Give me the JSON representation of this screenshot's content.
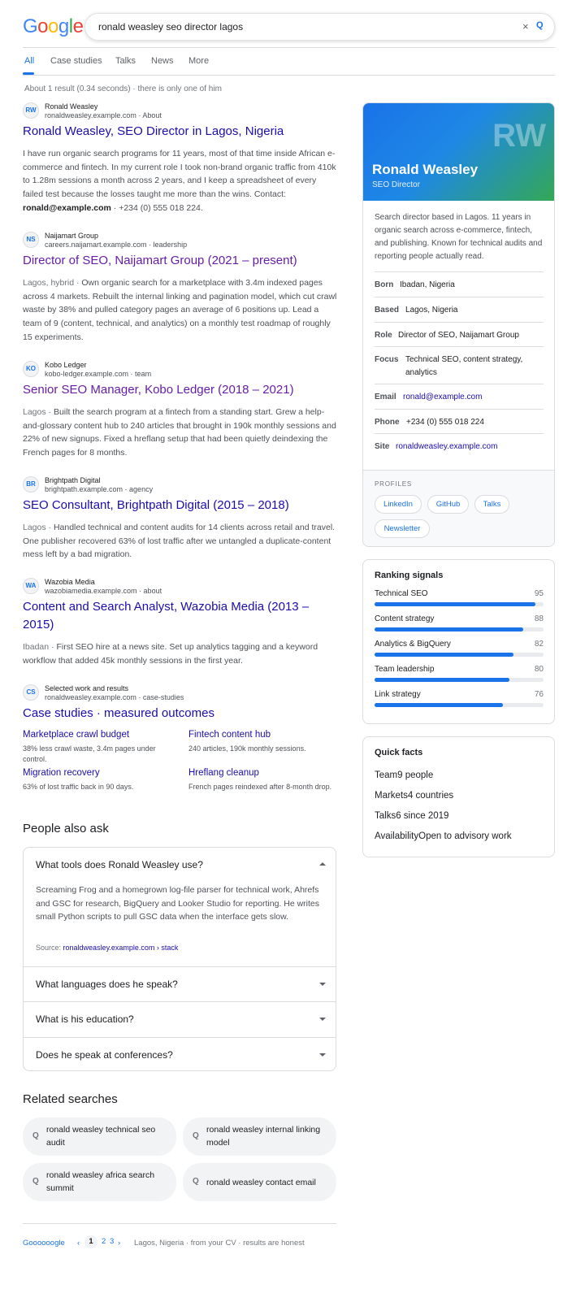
{
  "search": {
    "logo_letters": [
      {
        "char": "G",
        "color": "#4285f4"
      },
      {
        "char": "o",
        "color": "#ea4335"
      },
      {
        "char": "o",
        "color": "#fbbc05"
      },
      {
        "char": "g",
        "color": "#4285f4"
      },
      {
        "char": "l",
        "color": "#34a853"
      },
      {
        "char": "e",
        "color": "#ea4335"
      }
    ],
    "query": "ronald weasley seo director lagos",
    "clear_icon": "×",
    "search_icon": "Q"
  },
  "tabs": [
    "All",
    "Case studies",
    "Talks",
    "News",
    "More"
  ],
  "result_stats": "About 1 result (0.34 seconds) · there is only one of him",
  "results": [
    {
      "favicon": "RW",
      "site": "Ronald Weasley",
      "url": "ronaldweasley.example.com · About",
      "title": "Ronald Weasley, SEO Director in Lagos, Nigeria",
      "snippet_before": "I have run organic search programs for 11 years, most of that time inside African e-commerce and fintech. In my current role I took non-brand organic traffic from 410k to 1.28m sessions a month across 2 years, and I keep a spreadsheet of every failed test because the losses taught me more than the wins. Contact: ",
      "snippet_bold": "ronald@example.com",
      "snippet_after": " · +234 (0) 555 018 224."
    },
    {
      "favicon": "NS",
      "site": "Naijamart Group",
      "url": "careers.naijamart.example.com · leadership",
      "title": "Director of SEO, Naijamart Group (2021 – present)",
      "prefix": "Lagos, hybrid · ",
      "snippet": "Own organic search for a marketplace with 3.4m indexed pages across 4 markets. Rebuilt the internal linking and pagination model, which cut crawl waste by 38% and pulled category pages an average of 6 positions up. Lead a team of 9 (content, technical, and analytics) on a monthly test roadmap of roughly 15 experiments."
    },
    {
      "favicon": "KO",
      "site": "Kobo Ledger",
      "url": "kobo-ledger.example.com · team",
      "title": "Senior SEO Manager, Kobo Ledger (2018 – 2021)",
      "prefix": "Lagos · ",
      "snippet": "Built the search program at a fintech from a standing start. Grew a help-and-glossary content hub to 240 articles that brought in 190k monthly sessions and 22% of new signups. Fixed a hreflang setup that had been quietly deindexing the French pages for 8 months."
    },
    {
      "favicon": "BR",
      "site": "Brightpath Digital",
      "url": "brightpath.example.com · agency",
      "title": "SEO Consultant, Brightpath Digital (2015 – 2018)",
      "prefix": "Lagos · ",
      "snippet": "Handled technical and content audits for 14 clients across retail and travel. One publisher recovered 63% of lost traffic after we untangled a duplicate-content mess left by a bad migration."
    },
    {
      "favicon": "WA",
      "site": "Wazobia Media",
      "url": "wazobiamedia.example.com · about",
      "title": "Content and Search Analyst, Wazobia Media (2013 – 2015)",
      "prefix": "Ibadan · ",
      "snippet": "First SEO hire at a news site. Set up analytics tagging and a keyword workflow that added 45k monthly sessions in the first year."
    },
    {
      "favicon": "CS",
      "site": "Selected work and results",
      "url": "ronaldweasley.example.com · case-studies",
      "title": "Case studies · measured outcomes"
    }
  ],
  "case_studies": [
    {
      "title": "Marketplace crawl budget",
      "desc": "38% less crawl waste, 3.4m pages under control."
    },
    {
      "title": "Fintech content hub",
      "desc": "240 articles, 190k monthly sessions."
    },
    {
      "title": "Migration recovery",
      "desc": "63% of lost traffic back in 90 days."
    },
    {
      "title": "Hreflang cleanup",
      "desc": "French pages reindexed after 8-month drop."
    }
  ],
  "paa": {
    "title": "People also ask",
    "questions": [
      "What tools does Ronald Weasley use?",
      "What languages does he speak?",
      "What is his education?",
      "Does he speak at conferences?"
    ],
    "answer": "Screaming Frog and a homegrown log-file parser for technical work, Ahrefs and GSC for research, BigQuery and Looker Studio for reporting. He writes small Python scripts to pull GSC data when the interface gets slow.",
    "source_label": "Source: ",
    "source_link": "ronaldweasley.example.com › stack"
  },
  "related": {
    "title": "Related searches",
    "icon": "Q",
    "items": [
      "ronald weasley technical seo audit",
      "ronald weasley internal linking model",
      "ronald weasley africa search summit",
      "ronald weasley contact email"
    ]
  },
  "footer": {
    "logo": "Goooooogle",
    "prev": "‹",
    "pages": [
      "1",
      "2",
      "3"
    ],
    "next": "›",
    "note": "Lagos, Nigeria · from your CV · results are honest"
  },
  "knowledge_panel": {
    "monogram": "RW",
    "name": "Ronald Weasley",
    "role": "SEO Director",
    "description": "Search director based in Lagos. 11 years in organic search across e-commerce, fintech, and publishing. Known for technical audits and reporting people actually read.",
    "facts": [
      {
        "label": "Born",
        "value": "Ibadan, Nigeria"
      },
      {
        "label": "Based",
        "value": "Lagos, Nigeria"
      },
      {
        "label": "Role",
        "value": "Director of SEO, Naijamart Group"
      },
      {
        "label": "Focus",
        "value": "Technical SEO, content strategy, analytics"
      },
      {
        "label": "Email",
        "value": "ronald@example.com"
      },
      {
        "label": "Phone",
        "value": "+234 (0) 555 018 224"
      },
      {
        "label": "Site",
        "value": "ronaldweasley.example.com"
      }
    ],
    "profiles_title": "PROFILES",
    "profiles": [
      "LinkedIn",
      "GitHub",
      "Talks",
      "Newsletter"
    ]
  },
  "ranking_signals": {
    "title": "Ranking signals",
    "items": [
      {
        "label": "Technical SEO",
        "value": 95
      },
      {
        "label": "Content strategy",
        "value": 88
      },
      {
        "label": "Analytics & BigQuery",
        "value": 82
      },
      {
        "label": "Team leadership",
        "value": 80
      },
      {
        "label": "Link strategy",
        "value": 76
      }
    ]
  },
  "quick_facts": {
    "title": "Quick facts",
    "items": [
      {
        "label": "Team",
        "value": "9 people"
      },
      {
        "label": "Markets",
        "value": "4 countries"
      },
      {
        "label": "Talks",
        "value": "6 since 2019"
      },
      {
        "label": "Availability",
        "value": "Open to advisory work"
      }
    ]
  },
  "colors": {
    "link": "#1a0dab",
    "visited": "#681da8",
    "accent": "#1a73e8",
    "brand_green": "#34a853"
  }
}
